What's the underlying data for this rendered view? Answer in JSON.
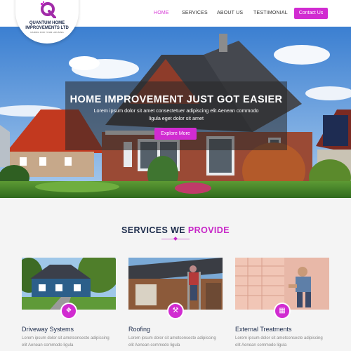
{
  "brand": {
    "name_line1": "QUANTUM HOME",
    "name_line2": "IMPROVEMENTS LTD",
    "tagline": "CARING FOR YOUR HOUSING"
  },
  "nav": {
    "items": [
      {
        "label": "HOME",
        "active": true
      },
      {
        "label": "SERVICES",
        "active": false
      },
      {
        "label": "ABOUT US",
        "active": false
      },
      {
        "label": "TESTIMONIAL",
        "active": false
      }
    ],
    "contact_label": "Contact Us"
  },
  "hero": {
    "title": "HOME IMPROVEMENT JUST GOT EASIER",
    "subtitle": "Lorem ipsum dolor sit amet consectetuer adipiscing elit Aenean commodo ligula eget dolor sit amet",
    "button_label": "Explore More"
  },
  "services": {
    "title_main": "SERVICES WE ",
    "title_accent": "PROVIDE",
    "cards": [
      {
        "title": "Driveway Systems",
        "text": "Lorem ipsum dolor sit ametconsecte adipiscing elit Aenean commodo ligula",
        "icon": "driveway-icon"
      },
      {
        "title": "Roofing",
        "text": "Lorem ipsum dolor sit ametconsecte adipiscing elit Aenean commodo ligula",
        "icon": "hammer-icon"
      },
      {
        "title": "External Treatments",
        "text": "Lorem ipsum dolor sit ametconsecte adipiscing elit Aenean commodo ligula",
        "icon": "treatment-icon"
      }
    ]
  },
  "colors": {
    "accent": "#d12bd1",
    "navy": "#1b2a4a"
  }
}
